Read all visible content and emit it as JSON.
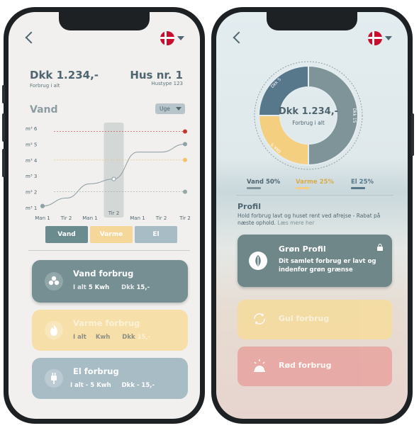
{
  "left": {
    "total": {
      "value": "Dkk 1.234,-",
      "label": "Forbrug i alt"
    },
    "house": {
      "value": "Hus nr. 1",
      "label": "Hustype 123"
    },
    "section_title": "Vand",
    "period_select": "Uge",
    "chart_data": {
      "type": "line",
      "y_tick_labels": [
        "m³ 6",
        "m³ 5",
        "m³ 4",
        "m³ 3",
        "m³ 2",
        "m³ 1"
      ],
      "ylim": [
        1,
        6
      ],
      "categories": [
        "Man 1",
        "Tir 2",
        "Man 1",
        "Tir 2",
        "Man 1",
        "Tir 2",
        "Tir 2"
      ],
      "values": [
        1.1,
        1.6,
        2.5,
        2.8,
        4.5,
        4.5,
        5.0
      ],
      "highlighted_category_index": 3,
      "reference_lines": [
        {
          "value": 5.8,
          "color": "#c0392b"
        },
        {
          "value": 4.0,
          "color": "#f2c36b"
        },
        {
          "value": 2.0,
          "color": "#94a9a5"
        }
      ],
      "marker_colors": [
        "#c0392b",
        "#8fa0a7",
        "#f2c36b",
        "#94a9a5"
      ]
    },
    "tabs": [
      {
        "label": "Vand",
        "color": "#6b8c8f"
      },
      {
        "label": "Varme",
        "color": "#f6d79a"
      },
      {
        "label": "El",
        "color": "#a8bcc6"
      }
    ],
    "cards": [
      {
        "title": "Vand forbrug",
        "row1_a": "I alt",
        "row1_b": "5 Kwh",
        "row1_c": "Dkk",
        "row1_d": "15,-",
        "color": "#768f93",
        "icon": "water-drops-icon"
      },
      {
        "title": "Varme forbrug",
        "row1_a": "I alt",
        "row1_b": "Kwh",
        "row1_c": "Dkk",
        "row1_d": "15,-",
        "color": "#f6dfa8",
        "icon": "flame-icon"
      },
      {
        "title": "El forbrug",
        "row1": "I alt - 5 Kwh",
        "row2": "Dkk - 15,-",
        "color": "#a8bcc6",
        "icon": "plug-icon"
      }
    ]
  },
  "right": {
    "donut": {
      "value": "Dkk 1.234,-",
      "label": "Forbrug i alt",
      "segments": [
        {
          "name": "Vand",
          "pct": 50,
          "color": "#7f9498",
          "label": "Dkk 15"
        },
        {
          "name": "Varme",
          "pct": 25,
          "color": "#f4cf80",
          "label": "Dkk 5"
        },
        {
          "name": "El",
          "pct": 25,
          "color": "#57778a",
          "label": "Dkk 5"
        }
      ]
    },
    "legend": [
      {
        "text": "Vand 50%",
        "color": "#4f6670",
        "bar": "#7f9498"
      },
      {
        "text": "Varme 25%",
        "color": "#d9ab4a",
        "bar": "#f4cf80"
      },
      {
        "text": "El 25%",
        "color": "#57778a",
        "bar": "#57778a"
      }
    ],
    "profil": {
      "title": "Profil",
      "desc": "Hold forbrug lavt og huset rent ved afrejse - Rabat på næste ophold.",
      "link": "Læs mere her"
    },
    "profiles": [
      {
        "title": "Grøn Profil",
        "desc": "Dit samlet forbrug er lavt og indenfor grøn grænse",
        "color": "#6f8789",
        "icon": "leaf-icon"
      },
      {
        "title": "Gul forbrug",
        "color": "#f7dc98",
        "icon": "recycle-icon"
      },
      {
        "title": "Rød forbrug",
        "color": "#e7a39f",
        "icon": "warning-icon"
      }
    ]
  }
}
